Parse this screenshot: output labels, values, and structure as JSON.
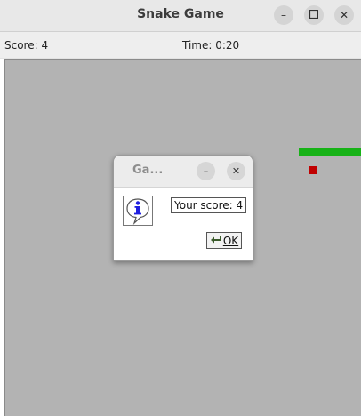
{
  "window": {
    "title": "Snake Game",
    "minimize_glyph": "–",
    "maximize_glyph": "☐",
    "close_glyph": "✕"
  },
  "status": {
    "score": "Score: 4",
    "time": "Time: 0:20"
  },
  "game": {
    "snake_color": "#17b217",
    "food_color": "#c00000",
    "background_color": "#b3b3b3"
  },
  "dialog": {
    "title": "Ga...",
    "minimize_glyph": "–",
    "close_glyph": "✕",
    "message": "Your score: 4",
    "ok_label": "OK",
    "icon": "info-icon"
  },
  "icons": {
    "minimize": "minimize-icon",
    "maximize": "maximize-icon",
    "close": "close-icon",
    "info": "info-icon",
    "ok": "check-arrow-icon"
  }
}
